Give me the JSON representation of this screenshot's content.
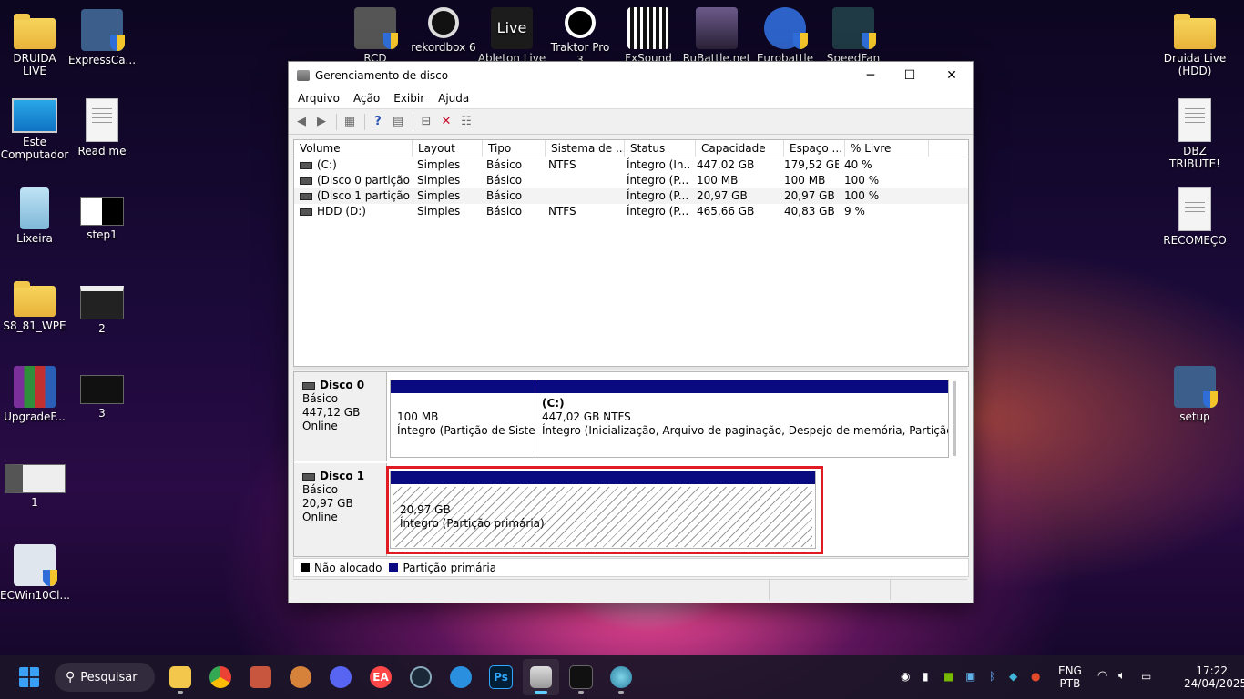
{
  "desktop": {
    "left_icons": [
      {
        "label": "DRUIDA LIVE",
        "icon": "folder-icon"
      },
      {
        "label": "ExpressCa...",
        "icon": "installer-icon"
      },
      {
        "label": "Este\nComputador",
        "icon": "monitor-icon"
      },
      {
        "label": "Read me",
        "icon": "document-icon"
      },
      {
        "label": "Lixeira",
        "icon": "recycle-bin-icon"
      },
      {
        "label": "step1",
        "icon": "image-thumbnail-icon"
      },
      {
        "label": "S8_81_WPE",
        "icon": "folder-icon"
      },
      {
        "label": "2",
        "icon": "image-thumbnail-icon"
      },
      {
        "label": "UpgradeF...",
        "icon": "archive-icon"
      },
      {
        "label": "3",
        "icon": "image-thumbnail-icon"
      },
      {
        "label": "1",
        "icon": "image-thumbnail-icon"
      },
      {
        "label": "ECWin10Cl...",
        "icon": "installer-icon"
      }
    ],
    "top_icons": [
      {
        "label": "RCD"
      },
      {
        "label": "rekordbox 6"
      },
      {
        "label": "Ableton Live"
      },
      {
        "label": "Traktor Pro 3"
      },
      {
        "label": "FxSound"
      },
      {
        "label": "RuBattle.net"
      },
      {
        "label": "Eurobattle"
      },
      {
        "label": "SpeedFan"
      }
    ],
    "ableton_glyph": "Live",
    "right_icons": [
      {
        "label": "Druida Live\n(HDD)",
        "icon": "folder-icon"
      },
      {
        "label": "DBZ TRIBUTE!",
        "icon": "document-icon"
      },
      {
        "label": "RECOMEÇO",
        "icon": "document-icon"
      },
      {
        "label": "setup",
        "icon": "installer-icon"
      }
    ]
  },
  "window": {
    "title": "Gerenciamento de disco",
    "menu": [
      "Arquivo",
      "Ação",
      "Exibir",
      "Ajuda"
    ],
    "columns": [
      "Volume",
      "Layout",
      "Tipo",
      "Sistema de ...",
      "Status",
      "Capacidade",
      "Espaço ...",
      "% Livre"
    ],
    "volumes": [
      [
        "(C:)",
        "Simples",
        "Básico",
        "NTFS",
        "Íntegro (In...",
        "447,02 GB",
        "179,52 GB",
        "40 %"
      ],
      [
        "(Disco 0 partição 1)",
        "Simples",
        "Básico",
        "",
        "Íntegro (P...",
        "100 MB",
        "100 MB",
        "100 %"
      ],
      [
        "(Disco 1 partição 1)",
        "Simples",
        "Básico",
        "",
        "Íntegro (P...",
        "20,97 GB",
        "20,97 GB",
        "100 %"
      ],
      [
        "HDD (D:)",
        "Simples",
        "Básico",
        "NTFS",
        "Íntegro (P...",
        "465,66 GB",
        "40,83 GB",
        "9 %"
      ]
    ],
    "disks": [
      {
        "name": "Disco 0",
        "type": "Básico",
        "size": "447,12 GB",
        "state": "Online",
        "partitions": [
          {
            "title": "",
            "size": "100 MB",
            "status": "Íntegro (Partição de Sistema"
          },
          {
            "title": "(C:)",
            "size": "447,02 GB NTFS",
            "status": "Íntegro (Inicialização, Arquivo de paginação, Despejo de memória, Partição de Dados"
          }
        ]
      },
      {
        "name": "Disco 1",
        "type": "Básico",
        "size": "20,97 GB",
        "state": "Online",
        "partitions": [
          {
            "title": "",
            "size": "20,97 GB",
            "status": "Íntegro (Partição primária)"
          }
        ]
      }
    ],
    "legend": [
      {
        "label": "Não alocado",
        "color": "#000000"
      },
      {
        "label": "Partição primária",
        "color": "#0a0a80"
      }
    ]
  },
  "taskbar": {
    "search_label": "Pesquisar",
    "apps": [
      "file-explorer-icon",
      "chrome-icon",
      "app-icon",
      "app-icon",
      "discord-icon",
      "ea-icon",
      "steam-icon",
      "app-icon",
      "photoshop-icon",
      "disk-management-icon",
      "terminal-icon",
      "app-icon"
    ],
    "ea_glyph": "EA",
    "ps_glyph": "Ps",
    "lang_top": "ENG",
    "lang_bottom": "PTB",
    "time": "17:22",
    "date": "24/04/2025"
  },
  "colors": {
    "accent": "#0a0a80",
    "highlight": "#e01b24"
  }
}
